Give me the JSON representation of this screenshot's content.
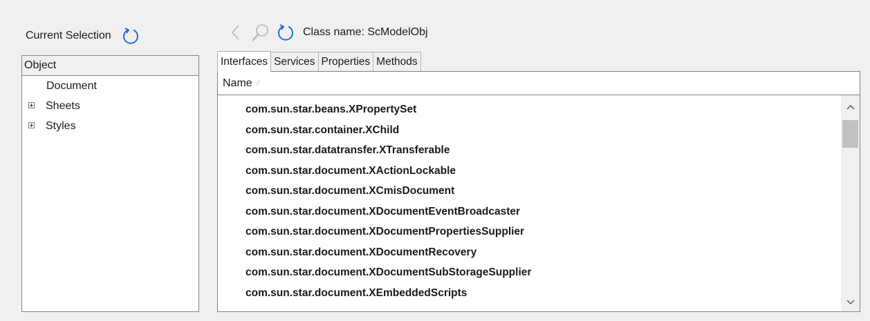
{
  "left_panel": {
    "current_selection_label": "Current Selection",
    "tree_header": "Object",
    "items": [
      {
        "label": "Document",
        "expandable": false
      },
      {
        "label": "Sheets",
        "expandable": true
      },
      {
        "label": "Styles",
        "expandable": true
      }
    ]
  },
  "toolbar": {
    "icons": [
      "back-arrow-icon",
      "search-icon",
      "refresh-icon"
    ],
    "class_name_label": "Class name:",
    "class_name_value": "ScModelObj"
  },
  "tabs": [
    {
      "label": "Interfaces",
      "active": true
    },
    {
      "label": "Services",
      "active": false
    },
    {
      "label": "Properties",
      "active": false
    },
    {
      "label": "Methods",
      "active": false
    }
  ],
  "list": {
    "column_header": "Name",
    "rows": [
      "com.sun.star.beans.XPropertySet",
      "com.sun.star.container.XChild",
      "com.sun.star.datatransfer.XTransferable",
      "com.sun.star.document.XActionLockable",
      "com.sun.star.document.XCmisDocument",
      "com.sun.star.document.XDocumentEventBroadcaster",
      "com.sun.star.document.XDocumentPropertiesSupplier",
      "com.sun.star.document.XDocumentRecovery",
      "com.sun.star.document.XDocumentSubStorageSupplier",
      "com.sun.star.document.XEmbeddedScripts"
    ]
  },
  "colors": {
    "accent_blue": "#1a6fd6",
    "disabled_gray": "#b4b4b4",
    "border": "#828282"
  }
}
